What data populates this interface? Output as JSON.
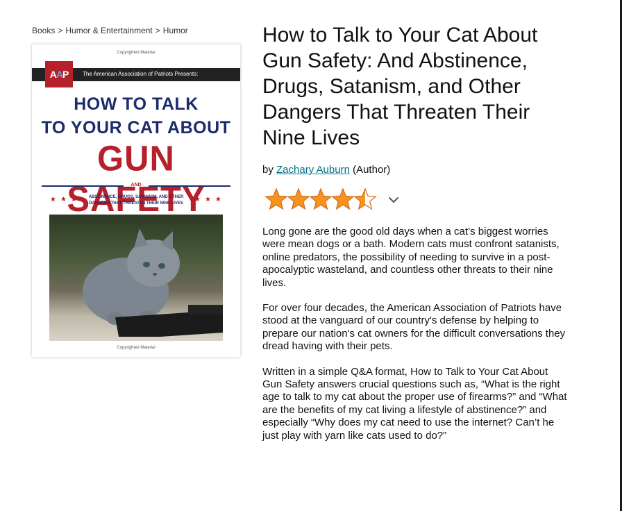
{
  "breadcrumb": {
    "items": [
      "Books",
      "Humor & Entertainment",
      "Humor"
    ],
    "separator": ">"
  },
  "cover": {
    "copyright_top": "Copyrighted Material",
    "logo_text": "AAP",
    "presents": "The American Association of Patriots Presents:",
    "line1": "HOW TO TALK",
    "line2": "TO YOUR CAT ABOUT",
    "headline": "GUN SAFETY",
    "and_label": "AND",
    "subtitle": "ABSTINENCE, DRUGS, SATANISM, AND OTHER DANGERS THAT THREATEN THEIR NINE LIVES",
    "copyright_bottom": "Copyrighted Material",
    "colors": {
      "navy": "#1c2c6b",
      "red": "#b5202a",
      "band": "#222222"
    }
  },
  "product": {
    "title": "How to Talk to Your Cat About Gun Safety: And Abstinence, Drugs, Satanism, and Other Dangers That Threaten Their Nine Lives",
    "by_prefix": "by",
    "author": "Zachary Auburn",
    "author_role": "(Author)",
    "rating": {
      "value": 4.5,
      "max": 5,
      "star_color": "#f7941d",
      "icon": "chevron-down-icon"
    }
  },
  "description": [
    "Long gone are the good old days when a cat’s biggest worries were mean dogs or a bath. Modern cats must confront satanists, online predators, the possibility of needing to survive in a post-apocalyptic wasteland, and countless other threats to their nine lives.",
    "For over four decades, the American Association of Patriots have stood at the vanguard of our country's defense by helping to prepare our nation's cat owners for the difficult conversations they dread having with their pets.",
    "Written in a simple Q&A format, How to Talk to Your Cat About Gun Safety answers crucial questions such as, “What is the right age to talk to my cat about the proper use of firearms?” and “What are the benefits of my cat living a lifestyle of abstinence?” and especially “Why does my cat need to use the internet? Can’t he just play with yarn like cats used to do?”"
  ]
}
